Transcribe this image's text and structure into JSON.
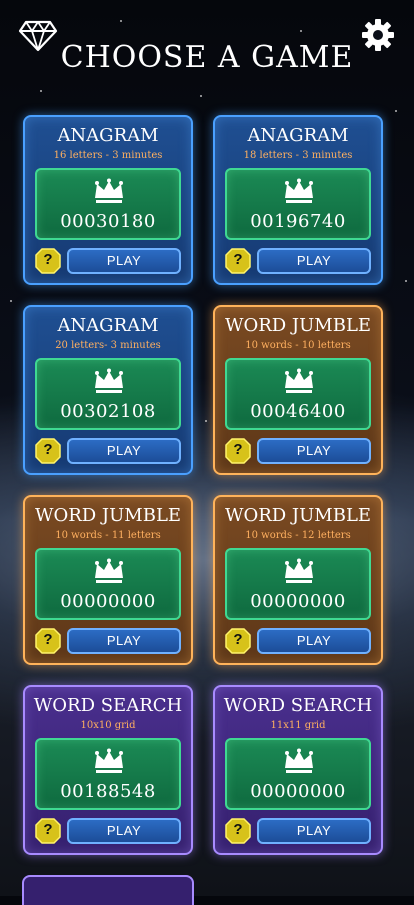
{
  "header": {
    "title": "CHOOSE A GAME",
    "left_icon": "diamond-icon",
    "right_icon": "gear-icon"
  },
  "colors": {
    "blue": "#4aa0ff",
    "orange": "#ffb35a",
    "purple": "#a88bff",
    "score_green": "#1b8a55",
    "subtitle": "#ffb060"
  },
  "cards": [
    {
      "title": "ANAGRAM",
      "subtitle": "16 letters - 3 minutes",
      "score": "00030180",
      "play_label": "PLAY",
      "help_label": "?",
      "theme": "blue"
    },
    {
      "title": "ANAGRAM",
      "subtitle": "18 letters - 3 minutes",
      "score": "00196740",
      "play_label": "PLAY",
      "help_label": "?",
      "theme": "blue"
    },
    {
      "title": "ANAGRAM",
      "subtitle": "20 letters- 3 minutes",
      "score": "00302108",
      "play_label": "PLAY",
      "help_label": "?",
      "theme": "blue"
    },
    {
      "title": "WORD JUMBLE",
      "subtitle": "10 words - 10 letters",
      "score": "00046400",
      "play_label": "PLAY",
      "help_label": "?",
      "theme": "orange"
    },
    {
      "title": "WORD JUMBLE",
      "subtitle": "10 words - 11 letters",
      "score": "00000000",
      "play_label": "PLAY",
      "help_label": "?",
      "theme": "orange"
    },
    {
      "title": "WORD JUMBLE",
      "subtitle": "10 words - 12 letters",
      "score": "00000000",
      "play_label": "PLAY",
      "help_label": "?",
      "theme": "orange"
    },
    {
      "title": "WORD SEARCH",
      "subtitle": "10x10 grid",
      "score": "00188548",
      "play_label": "PLAY",
      "help_label": "?",
      "theme": "purple"
    },
    {
      "title": "WORD SEARCH",
      "subtitle": "11x11 grid",
      "score": "00000000",
      "play_label": "PLAY",
      "help_label": "?",
      "theme": "purple"
    }
  ]
}
